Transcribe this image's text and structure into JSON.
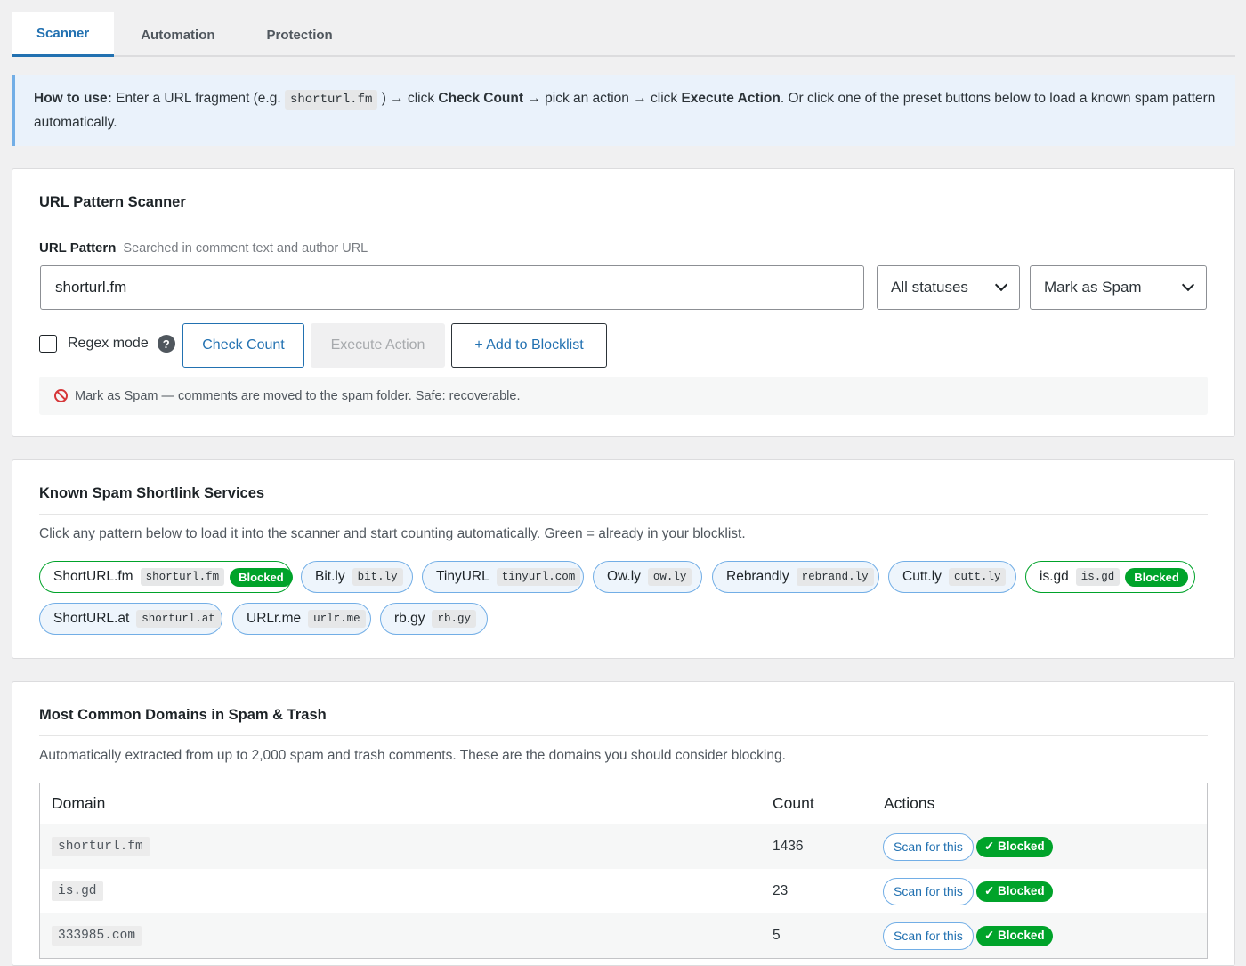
{
  "tabs": [
    {
      "label": "Scanner",
      "active": true
    },
    {
      "label": "Automation",
      "active": false
    },
    {
      "label": "Protection",
      "active": false
    }
  ],
  "notice": {
    "lead": "How to use:",
    "t1": " Enter a URL fragment (e.g. ",
    "code": "shorturl.fm",
    "t2": " ) → click ",
    "b1": "Check Count",
    "t3": " → pick an action → click ",
    "b2": "Execute Action",
    "t4": ". Or click one of the preset buttons below to load a known spam pattern automatically."
  },
  "scanner": {
    "title": "URL Pattern Scanner",
    "field_label": "URL Pattern",
    "field_hint": "Searched in comment text and author URL",
    "url_value": "shorturl.fm",
    "status_select": "All statuses",
    "action_select": "Mark as Spam",
    "regex_label": "Regex mode",
    "help_glyph": "?",
    "check_count": "Check Count",
    "execute_action": "Execute Action",
    "add_blocklist": "+ Add to Blocklist",
    "info_text": "Mark as Spam — comments are moved to the spam folder. Safe: recoverable."
  },
  "services": {
    "title": "Known Spam Shortlink Services",
    "desc": "Click any pattern below to load it into the scanner and start counting automatically. Green = already in your blocklist.",
    "items": [
      {
        "name": "ShortURL.fm",
        "pattern": "shorturl.fm",
        "blocked": "Blocked"
      },
      {
        "name": "Bit.ly",
        "pattern": "bit.ly"
      },
      {
        "name": "TinyURL",
        "pattern": "tinyurl.com"
      },
      {
        "name": "Ow.ly",
        "pattern": "ow.ly"
      },
      {
        "name": "Rebrandly",
        "pattern": "rebrand.ly"
      },
      {
        "name": "Cutt.ly",
        "pattern": "cutt.ly"
      },
      {
        "name": "is.gd",
        "pattern": "is.gd",
        "blocked": "Blocked"
      },
      {
        "name": "ShortURL.at",
        "pattern": "shorturl.at"
      },
      {
        "name": "URLr.me",
        "pattern": "urlr.me"
      },
      {
        "name": "rb.gy",
        "pattern": "rb.gy"
      }
    ]
  },
  "domains": {
    "title": "Most Common Domains in Spam & Trash",
    "desc": "Automatically extracted from up to 2,000 spam and trash comments. These are the domains you should consider blocking.",
    "columns": {
      "domain": "Domain",
      "count": "Count",
      "actions": "Actions"
    },
    "scan_label": "Scan for this",
    "blocked_label": "✓ Blocked",
    "rows": [
      {
        "domain": "shorturl.fm",
        "count": "1436"
      },
      {
        "domain": "is.gd",
        "count": "23"
      },
      {
        "domain": "333985.com",
        "count": "5"
      }
    ]
  },
  "colors": {
    "accent": "#2271b1",
    "success": "#00a32a",
    "danger": "#d63638"
  }
}
